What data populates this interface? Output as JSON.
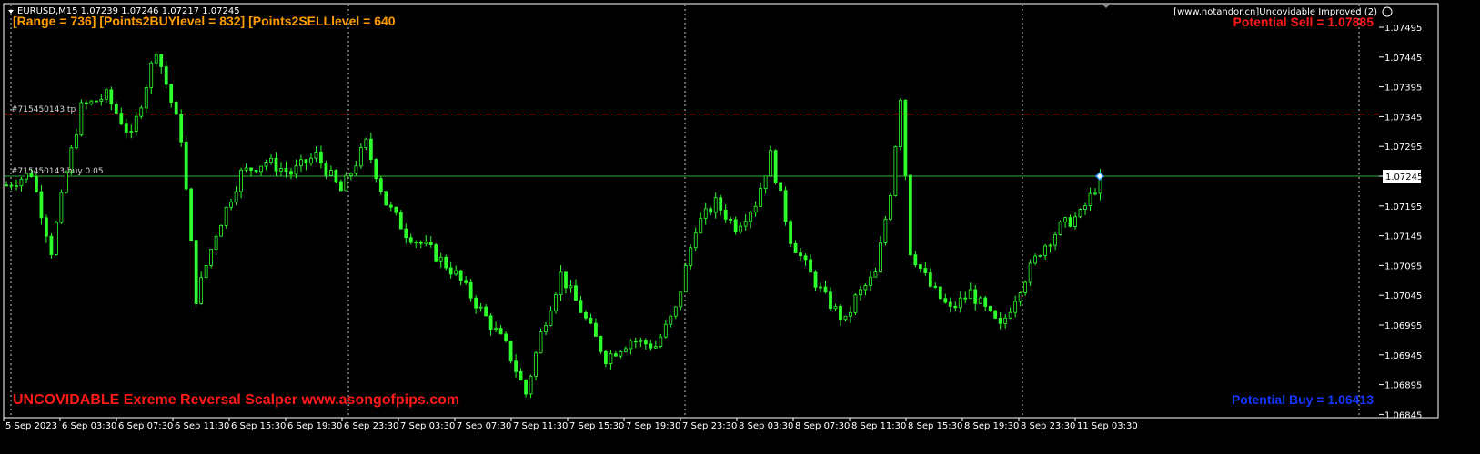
{
  "header": {
    "symbol_text": "EURUSD,M15  1.07239 1.07246 1.07217 1.07245",
    "stats_text": "[Range = 736]  [Points2BUYlevel = 832]  [Points2SELLlevel = 640",
    "copyright_text": "[www.notandor.cn]Uncovidable Improved (2)",
    "potential_sell_text": "Potential Sell = 1.07885"
  },
  "footer": {
    "brand_text": "UNCOVIDABLE Exreme Reversal Scalper www.asongofpips.com",
    "potential_buy_text": "Potential Buy = 1.06413"
  },
  "orders": {
    "tp_label": "#715450143 tp",
    "tp_price": 1.07349,
    "buy_label": "#715450143 buy 0.05",
    "buy_price": 1.07245
  },
  "colors": {
    "candle": "#2cff2c",
    "grid": "#c8c8c8",
    "tp_line": "#c8201e",
    "buy_line": "#2fb02f",
    "current_marker": "#2c9cff"
  },
  "chart_data": {
    "type": "candlestick",
    "symbol": "EURUSD",
    "timeframe": "M15",
    "last_bar": {
      "open": 1.07239,
      "high": 1.07246,
      "low": 1.07217,
      "close": 1.07245
    },
    "current_price": 1.07245,
    "ylim": [
      1.06845,
      1.07545
    ],
    "y_ticks": [
      "1.07495",
      "1.07445",
      "1.07395",
      "1.07345",
      "1.07295",
      "1.07245",
      "1.07195",
      "1.07145",
      "1.07095",
      "1.07045",
      "1.06995",
      "1.06945",
      "1.06895",
      "1.06845"
    ],
    "x_ticks": [
      "5 Sep 2023",
      "6 Sep 03:30",
      "6 Sep 07:30",
      "6 Sep 11:30",
      "6 Sep 15:30",
      "6 Sep 19:30",
      "6 Sep 23:30",
      "7 Sep 03:30",
      "7 Sep 07:30",
      "7 Sep 11:30",
      "7 Sep 15:30",
      "7 Sep 19:30",
      "7 Sep 23:30",
      "8 Sep 03:30",
      "8 Sep 07:30",
      "8 Sep 11:30",
      "8 Sep 15:30",
      "8 Sep 19:30",
      "8 Sep 23:30",
      "11 Sep 03:30"
    ],
    "day_separators_after": [
      "6 Sep 23:30",
      "7 Sep 23:30",
      "8 Sep 23:30"
    ],
    "grid": false,
    "close_path": [
      [
        0,
        1.0723
      ],
      [
        5,
        1.0725
      ],
      [
        9,
        1.0712
      ],
      [
        12,
        1.0725
      ],
      [
        15,
        1.0736
      ],
      [
        20,
        1.0738
      ],
      [
        25,
        1.0731
      ],
      [
        30,
        1.0746
      ],
      [
        35,
        1.0731
      ],
      [
        38,
        1.0704
      ],
      [
        42,
        1.0715
      ],
      [
        47,
        1.0725
      ],
      [
        52,
        1.0727
      ],
      [
        57,
        1.0725
      ],
      [
        62,
        1.0728
      ],
      [
        67,
        1.0722
      ],
      [
        72,
        1.073
      ],
      [
        76,
        1.072
      ],
      [
        80,
        1.0715
      ],
      [
        85,
        1.0712
      ],
      [
        90,
        1.0708
      ],
      [
        95,
        1.0702
      ],
      [
        100,
        1.0696
      ],
      [
        104,
        1.0688
      ],
      [
        107,
        1.0698
      ],
      [
        111,
        1.0708
      ],
      [
        115,
        1.0702
      ],
      [
        120,
        1.0694
      ],
      [
        125,
        1.0697
      ],
      [
        130,
        1.0696
      ],
      [
        134,
        1.0702
      ],
      [
        138,
        1.0716
      ],
      [
        142,
        1.072
      ],
      [
        146,
        1.0716
      ],
      [
        150,
        1.072
      ],
      [
        153,
        1.0728
      ],
      [
        157,
        1.0714
      ],
      [
        161,
        1.0708
      ],
      [
        164,
        1.0704
      ],
      [
        168,
        1.07
      ],
      [
        170,
        1.0704
      ],
      [
        174,
        1.0708
      ],
      [
        177,
        1.0722
      ],
      [
        179,
        1.0738
      ],
      [
        181,
        1.0712
      ],
      [
        185,
        1.0706
      ],
      [
        189,
        1.0702
      ],
      [
        193,
        1.0705
      ],
      [
        196,
        1.0702
      ],
      [
        199,
        1.0699
      ],
      [
        203,
        1.0706
      ],
      [
        207,
        1.0712
      ],
      [
        211,
        1.0716
      ],
      [
        215,
        1.0718
      ],
      [
        219,
        1.0724
      ]
    ]
  }
}
